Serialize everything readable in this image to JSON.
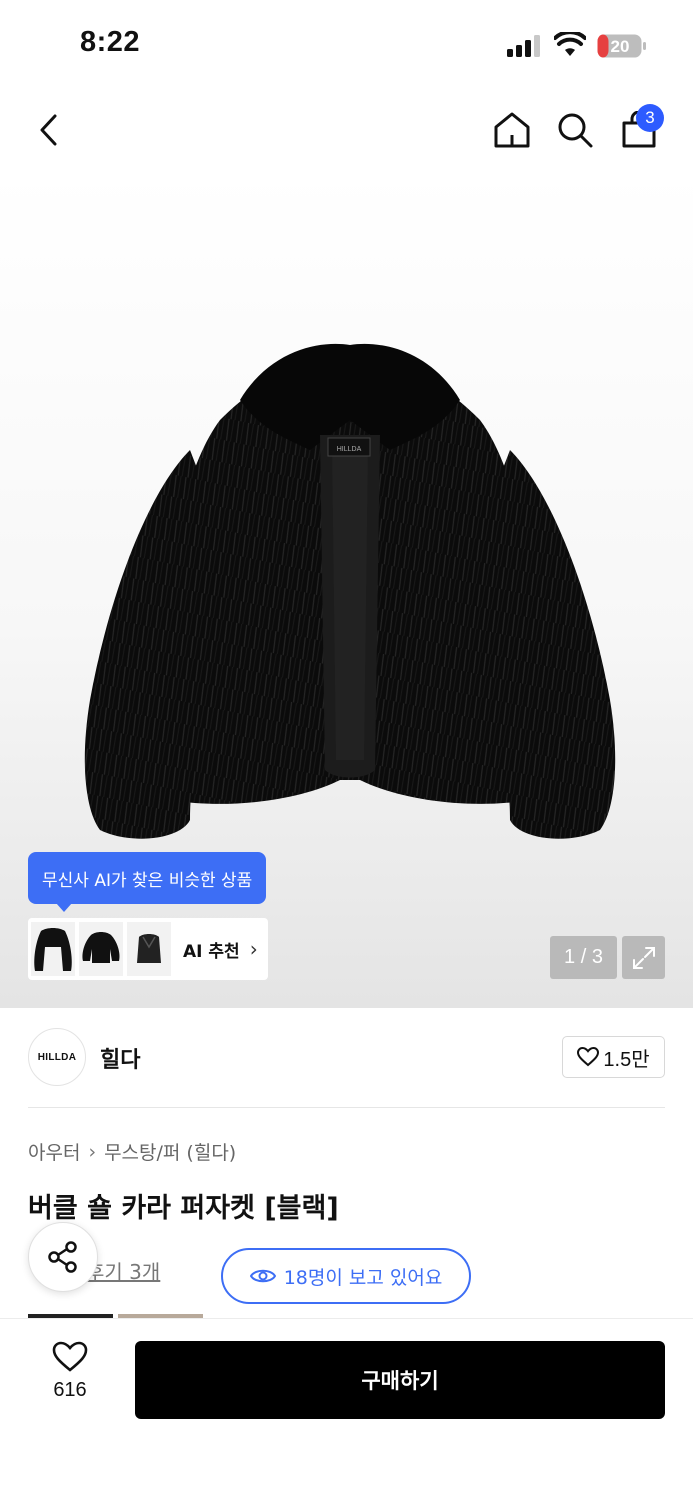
{
  "status_bar": {
    "time": "8:22",
    "battery": "20"
  },
  "nav": {
    "cart_count": "3"
  },
  "gallery": {
    "ai_tooltip": "무신사 AI가 찾은 비슷한 상품",
    "ai_reco_label": "AI 추천",
    "page_indicator": "1 / 3",
    "jacket_label": "HILLDA"
  },
  "brand": {
    "logo_text": "HILLDA",
    "name": "힐다",
    "like_count": "1.5만"
  },
  "breadcrumb": {
    "category": "아우터",
    "subcategory": "무스탕/퍼 (힐다)"
  },
  "product": {
    "title": "버클 숄 카라 퍼자켓 [블랙]"
  },
  "review": {
    "link_text": "후기 3개"
  },
  "viewers": {
    "text": "18명이 보고 있어요"
  },
  "bottom_bar": {
    "wish_count": "616",
    "buy_label": "구매하기"
  },
  "colors": {
    "accent": "#3d6ef5",
    "badge": "#2d5bff",
    "buy_button": "#000000"
  }
}
